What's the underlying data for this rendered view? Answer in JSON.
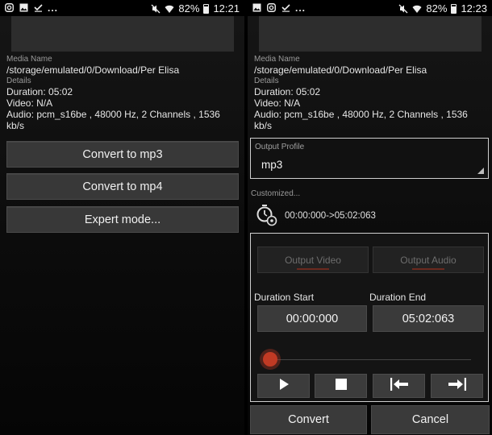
{
  "left": {
    "status": {
      "time": "12:21",
      "battery": "82%"
    },
    "media_name_label": "Media Name",
    "media_path": "/storage/emulated/0/Download/Per Elisa",
    "details_label": "Details",
    "duration": "Duration: 05:02",
    "video": "Video: N/A",
    "audio": "Audio: pcm_s16be , 48000 Hz, 2 Channels , 1536 kb/s",
    "buttons": [
      "Convert to mp3",
      "Convert to mp4",
      "Expert mode..."
    ]
  },
  "right": {
    "status": {
      "time": "12:23",
      "battery": "82%"
    },
    "media_name_label": "Media Name",
    "media_path": "/storage/emulated/0/Download/Per Elisa",
    "details_label": "Details",
    "duration": "Duration: 05:02",
    "video": "Video: N/A",
    "audio": "Audio: pcm_s16be , 48000 Hz, 2 Channels , 1536 kb/s",
    "output_profile_label": "Output Profile",
    "output_profile_value": "mp3",
    "customized_label": "Customized...",
    "time_range": "00:00:000->05:02:063",
    "output_video_label": "Output Video",
    "output_audio_label": "Output Audio",
    "duration_start_label": "Duration Start",
    "duration_end_label": "Duration End",
    "duration_start_value": "00:00:000",
    "duration_end_value": "05:02:063",
    "slider_position": 0,
    "convert_label": "Convert",
    "cancel_label": "Cancel"
  },
  "icons": {
    "status_left": [
      "instagram-icon",
      "gallery-icon",
      "download-done-icon",
      "more-dots-icon"
    ],
    "status_right": [
      "mute-icon",
      "wifi-icon",
      "battery-icon"
    ],
    "controls": [
      "play-icon",
      "stop-icon",
      "set-start-icon",
      "set-end-icon"
    ],
    "timer": "stopwatch-settings-icon"
  },
  "colors": {
    "accent": "#c03a24",
    "panel_bg": "#111111",
    "button_bg": "#383838"
  }
}
